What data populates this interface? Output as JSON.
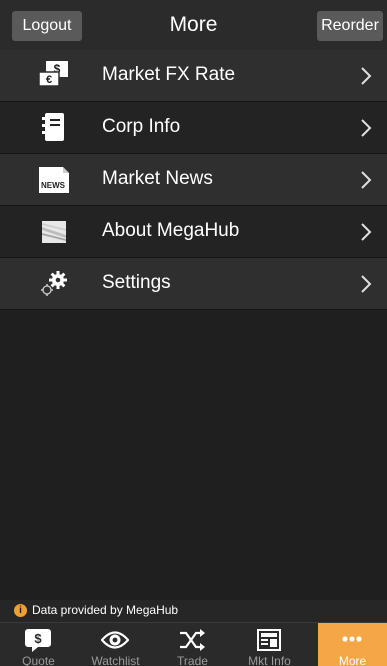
{
  "header": {
    "left_button": "Logout",
    "title": "More",
    "right_button": "Reorder"
  },
  "menu": {
    "items": [
      {
        "label": "Market FX Rate",
        "icon": "currency-exchange-icon"
      },
      {
        "label": "Corp Info",
        "icon": "notebook-icon"
      },
      {
        "label": "Market News",
        "icon": "news-icon"
      },
      {
        "label": "About MegaHub",
        "icon": "megahub-logo-icon"
      },
      {
        "label": "Settings",
        "icon": "gears-icon"
      }
    ],
    "news_icon_text": "NEWS"
  },
  "footer": {
    "info_glyph": "i",
    "provider_text": "Data provided by MegaHub"
  },
  "tabbar": {
    "tabs": [
      {
        "label": "Quote",
        "icon": "quote-icon"
      },
      {
        "label": "Watchlist",
        "icon": "eye-icon"
      },
      {
        "label": "Trade",
        "icon": "shuffle-icon"
      },
      {
        "label": "Mkt Info",
        "icon": "market-info-icon"
      },
      {
        "label": "More",
        "icon": "more-dots-icon",
        "active": true
      }
    ]
  },
  "colors": {
    "background": "#1f1f1f",
    "header": "#2b2b2b",
    "header_button": "#5a5a5a",
    "row_alt": "#2f2f2f",
    "accent": "#f5a646",
    "tab_inactive_text": "#9b9b9b"
  }
}
